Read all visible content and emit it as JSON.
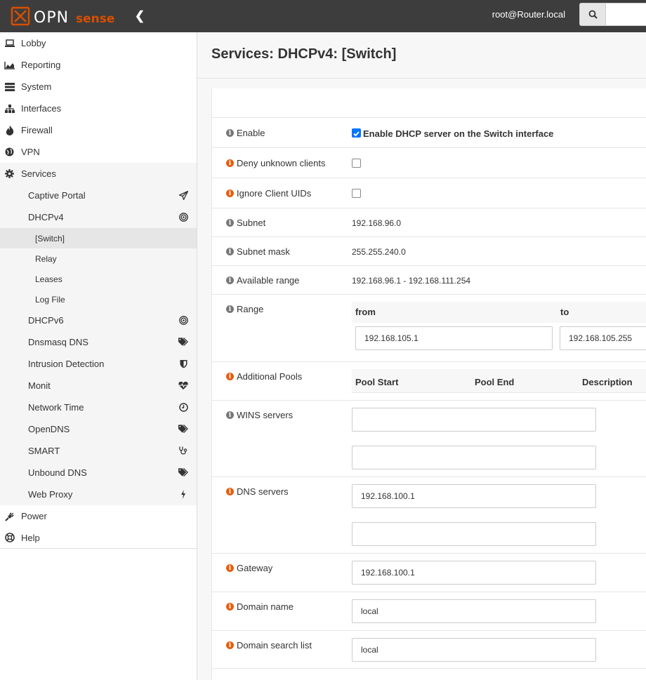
{
  "header": {
    "logo_text": "OPNsense",
    "user": "root@Router.local",
    "search_placeholder": ""
  },
  "sidebar": {
    "items": [
      {
        "label": "Lobby",
        "icon": "laptop-icon"
      },
      {
        "label": "Reporting",
        "icon": "area-chart-icon"
      },
      {
        "label": "System",
        "icon": "server-icon"
      },
      {
        "label": "Interfaces",
        "icon": "sitemap-icon"
      },
      {
        "label": "Firewall",
        "icon": "fire-icon"
      },
      {
        "label": "VPN",
        "icon": "globe-icon"
      },
      {
        "label": "Services",
        "icon": "cog-icon"
      }
    ],
    "services_sub": [
      {
        "label": "Captive Portal",
        "icon": "paper-plane-icon"
      },
      {
        "label": "DHCPv4",
        "icon": "bullseye-icon"
      }
    ],
    "dhcpv4_sub": [
      "[Switch]",
      "Relay",
      "Leases",
      "Log File"
    ],
    "services_sub2": [
      {
        "label": "DHCPv6",
        "icon": "bullseye-icon"
      },
      {
        "label": "Dnsmasq DNS",
        "icon": "tags-icon"
      },
      {
        "label": "Intrusion Detection",
        "icon": "shield-icon"
      },
      {
        "label": "Monit",
        "icon": "heartbeat-icon"
      },
      {
        "label": "Network Time",
        "icon": "clock-icon"
      },
      {
        "label": "OpenDNS",
        "icon": "tags-icon"
      },
      {
        "label": "SMART",
        "icon": "stethoscope-icon"
      },
      {
        "label": "Unbound DNS",
        "icon": "tags-icon"
      },
      {
        "label": "Web Proxy",
        "icon": "bolt-icon"
      }
    ],
    "bottom": [
      {
        "label": "Power",
        "icon": "plug-icon"
      },
      {
        "label": "Help",
        "icon": "life-ring-icon"
      }
    ]
  },
  "page": {
    "title": "Services: DHCPv4: [Switch]"
  },
  "form": {
    "enable_label": "Enable",
    "enable_text": "Enable DHCP server on the Switch interface",
    "enable_checked": true,
    "deny_label": "Deny unknown clients",
    "deny_checked": false,
    "ignore_label": "Ignore Client UIDs",
    "ignore_checked": false,
    "subnet_label": "Subnet",
    "subnet_value": "192.168.96.0",
    "mask_label": "Subnet mask",
    "mask_value": "255.255.240.0",
    "avail_label": "Available range",
    "avail_value": "192.168.96.1 - 192.168.111.254",
    "range_label": "Range",
    "range_from_header": "from",
    "range_to_header": "to",
    "range_from": "192.168.105.1",
    "range_to": "192.168.105.255",
    "pools_label": "Additional Pools",
    "pools_headers": [
      "Pool Start",
      "Pool End",
      "Description"
    ],
    "wins_label": "WINS servers",
    "wins_1": "",
    "wins_2": "",
    "dns_label": "DNS servers",
    "dns_1": "192.168.100.1",
    "dns_2": "",
    "gateway_label": "Gateway",
    "gateway_value": "192.168.100.1",
    "domain_label": "Domain name",
    "domain_value": "local",
    "search_label": "Domain search list",
    "search_value": "local"
  }
}
